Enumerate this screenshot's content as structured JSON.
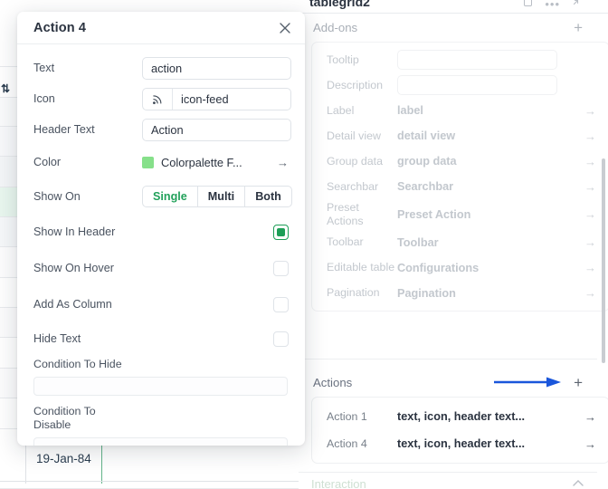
{
  "background_table": {
    "cell_value": "19-Jan-84",
    "sort_icon": "sort-arrows-icon"
  },
  "modal": {
    "title": "Action 4",
    "close_icon": "close-icon",
    "fields": [
      {
        "label": "Text",
        "type": "input",
        "value": "action"
      },
      {
        "label": "Icon",
        "type": "icon-input",
        "icon": "rss-feed-icon",
        "value": "icon-feed"
      },
      {
        "label": "Header Text",
        "type": "input",
        "value": "Action"
      },
      {
        "label": "Color",
        "type": "color",
        "value": "Colorpalette F...",
        "swatch_hex": "#86e08a",
        "arrow_icon": "arrow-right-icon"
      },
      {
        "label": "Show On",
        "type": "segmented",
        "options": [
          "Single",
          "Multi",
          "Both"
        ],
        "selected": "Single"
      },
      {
        "label": "Show In Header",
        "type": "checkbox",
        "checked": true
      },
      {
        "label": "Show On Hover",
        "type": "checkbox",
        "checked": false
      },
      {
        "label": "Add As Column",
        "type": "checkbox",
        "checked": false
      },
      {
        "label": "Hide Text",
        "type": "checkbox",
        "checked": false
      }
    ],
    "condition_to_hide": {
      "label": "Condition To Hide",
      "value": ""
    },
    "condition_to_disable": {
      "label": "Condition To\nDisable",
      "value": ""
    }
  },
  "right_panel": {
    "title": "tablegrid2",
    "title_icons": [
      "duplicate-icon",
      "more-options-icon",
      "expand-icon"
    ],
    "addons": {
      "heading": "Add-ons",
      "add_icon": "plus-icon",
      "rows": [
        {
          "key": "Tooltip",
          "value": "",
          "kind": "input"
        },
        {
          "key": "Description",
          "value": "",
          "kind": "input"
        },
        {
          "key": "Label",
          "value": "label",
          "kind": "link",
          "arrow_icon": "arrow-right-icon"
        },
        {
          "key": "Detail view",
          "value": "detail view",
          "kind": "link",
          "arrow_icon": "arrow-right-icon"
        },
        {
          "key": "Group data",
          "value": "group data",
          "kind": "link",
          "arrow_icon": "arrow-right-icon"
        },
        {
          "key": "Searchbar",
          "value": "Searchbar",
          "kind": "link",
          "arrow_icon": "arrow-right-icon"
        },
        {
          "key": "Preset Actions",
          "value": "Preset Action",
          "kind": "link",
          "arrow_icon": "arrow-right-icon"
        },
        {
          "key": "Toolbar",
          "value": "Toolbar",
          "kind": "link",
          "arrow_icon": "arrow-right-icon"
        },
        {
          "key": "Editable table",
          "value": "Configurations",
          "kind": "link",
          "arrow_icon": "arrow-right-icon"
        },
        {
          "key": "Pagination",
          "value": "Pagination",
          "kind": "link",
          "arrow_icon": "arrow-right-icon"
        }
      ]
    },
    "actions": {
      "heading": "Actions",
      "add_icon": "plus-icon",
      "annotation_arrow_color": "#1a56db",
      "rows": [
        {
          "key": "Action 1",
          "value": "text, icon, header text...",
          "arrow_icon": "arrow-right-icon"
        },
        {
          "key": "Action 4",
          "value": "text, icon, header text...",
          "arrow_icon": "arrow-right-icon"
        }
      ]
    }
  }
}
